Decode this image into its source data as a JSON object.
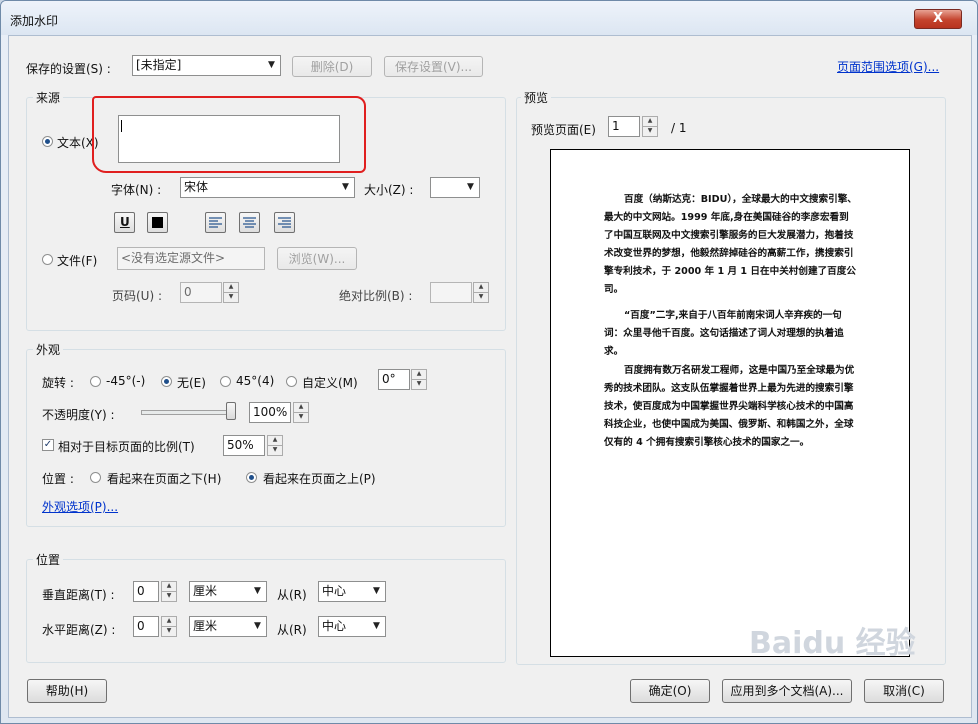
{
  "window": {
    "title": "添加水印",
    "close": "X"
  },
  "top": {
    "saved_settings_label": "保存的设置(S) :",
    "saved_settings_value": "[未指定]",
    "delete_label": "删除(D)",
    "save_settings_label": "保存设置(V)...",
    "page_range_link": "页面范围选项(G)..."
  },
  "source": {
    "group_label": "来源",
    "text_radio_label": "文本(X)",
    "text_value": "",
    "font_label": "字体(N) :",
    "font_value": "宋体",
    "size_label": "大小(Z) :",
    "size_value": "",
    "underline_label": "U",
    "file_radio_label": "文件(F)",
    "file_value": "<没有选定源文件>",
    "browse_label": "浏览(W)...",
    "page_label": "页码(U) :",
    "page_value": "0",
    "scale_label": "绝对比例(B) :",
    "scale_value": ""
  },
  "appearance": {
    "group_label": "外观",
    "rotation_label": "旋转 :",
    "rot_options": [
      "-45°(-)",
      "无(E)",
      "45°(4)",
      "自定义(M)"
    ],
    "rot_selected": 1,
    "custom_angle": "0°",
    "opacity_label": "不透明度(Y) :",
    "opacity_value": "100%",
    "opacity_level": 1.0,
    "relative_label": "相对于目标页面的比例(T)",
    "relative_checked": true,
    "relative_value": "50%",
    "position_label": "位置 :",
    "pos_options": [
      "看起来在页面之下(H)",
      "看起来在页面之上(P)"
    ],
    "pos_selected": 1,
    "options_link": "外观选项(P)..."
  },
  "position": {
    "group_label": "位置",
    "vertical_label": "垂直距离(T) :",
    "vertical_value": "0",
    "vertical_unit": "厘米",
    "vertical_from_label": "从(R)",
    "vertical_from": "中心",
    "horizontal_label": "水平距离(Z) :",
    "horizontal_value": "0",
    "horizontal_unit": "厘米",
    "horizontal_from_label": "从(R)",
    "horizontal_from": "中心"
  },
  "preview": {
    "group_label": "预览",
    "page_label": "预览页面(E)",
    "page_value": "1",
    "page_total": "/ 1",
    "paragraphs": [
      "百度（纳斯达克：BIDU），全球最大的中文搜索引擎、最大的中文网站。1999 年底,身在美国硅谷的李彦宏看到了中国互联网及中文搜索引擎服务的巨大发展潜力，抱着技术改变世界的梦想，他毅然辞掉硅谷的高薪工作，携搜索引擎专利技术，于 2000 年 1 月 1 日在中关村创建了百度公司。",
      "“百度”二字,来自于八百年前南宋词人辛弃疾的一句词：众里寻他千百度。这句话描述了词人对理想的执着追求。",
      "百度拥有数万名研发工程师，这是中国乃至全球最为优秀的技术团队。这支队伍掌握着世界上最为先进的搜索引擎技术，使百度成为中国掌握世界尖端科学核心技术的中国高科技企业，也使中国成为美国、俄罗斯、和韩国之外，全球仅有的 4 个拥有搜索引擎核心技术的国家之一。"
    ]
  },
  "bottom": {
    "help_label": "帮助(H)",
    "ok_label": "确定(O)",
    "apply_label": "应用到多个文档(A)...",
    "cancel_label": "取消(C)"
  },
  "watermark_text": "Baidu 经验"
}
